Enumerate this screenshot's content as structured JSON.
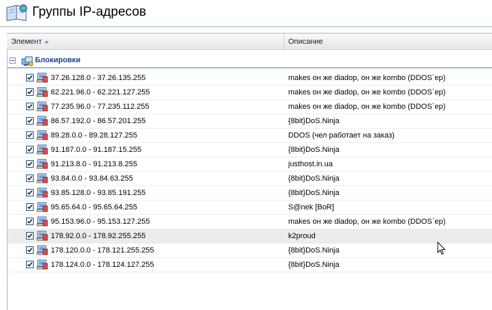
{
  "header": {
    "title": "Группы IP-адресов"
  },
  "columns": {
    "element": "Элемент",
    "description": "Описание"
  },
  "group": {
    "label": "Блокировки"
  },
  "rows": [
    {
      "range": "37.26.128.0 - 37.26.135.255",
      "description": "makes он же diadop, он же kombo (DDOS`ер)",
      "checked": true
    },
    {
      "range": "62.221.96.0 - 62.221.127.255",
      "description": "makes он же diadop, он же kombo (DDOS`ер)",
      "checked": true
    },
    {
      "range": "77.235.96.0 - 77.235.112.255",
      "description": "makes он же diadop, он же kombo (DDOS`ер)",
      "checked": true
    },
    {
      "range": "86.57.192.0 - 86.57.201.255",
      "description": "{8bit}DoS.Ninja",
      "checked": true
    },
    {
      "range": "89.28.0.0 - 89.28.127.255",
      "description": "DDOS (чел работает на заказ)",
      "checked": true
    },
    {
      "range": "91.187.0.0 - 91.187.15.255",
      "description": "{8bit}DoS.Ninja",
      "checked": true
    },
    {
      "range": "91.213.8.0 - 91.213.8.255",
      "description": "justhost.in.ua",
      "checked": true
    },
    {
      "range": "93.84.0.0 - 93.84.63.255",
      "description": "{8bit}DoS.Ninja",
      "checked": true
    },
    {
      "range": "93.85.128.0 - 93.85.191.255",
      "description": "{8bit}DoS.Ninja",
      "checked": true
    },
    {
      "range": "95.65.64.0 - 95.65.64.255",
      "description": "S@nek [BoR]",
      "checked": true
    },
    {
      "range": "95.153.96.0 - 95.153.127.255",
      "description": "makes он же diadop, он же kombo (DDOS`ер)",
      "checked": true
    },
    {
      "range": "178.92.0.0 - 178.92.255.255",
      "description": "k2proud",
      "checked": true,
      "selected": true
    },
    {
      "range": "178.120.0.0 - 178.121.255.255",
      "description": "{8bit}DoS.Ninja",
      "checked": true
    },
    {
      "range": "178.124.0.0 - 178.124.127.255",
      "description": "{8bit}DoS.Ninja",
      "checked": true
    }
  ],
  "icons": {
    "header": "address-book-icon",
    "group": "group-computers-icon",
    "row": "network-range-icon",
    "sort": "sort-ascending-icon",
    "cursor": "mouse-cursor-icon"
  },
  "colors": {
    "accent": "#15428b",
    "border": "#99bbe8",
    "selected_row": "#ececec"
  }
}
